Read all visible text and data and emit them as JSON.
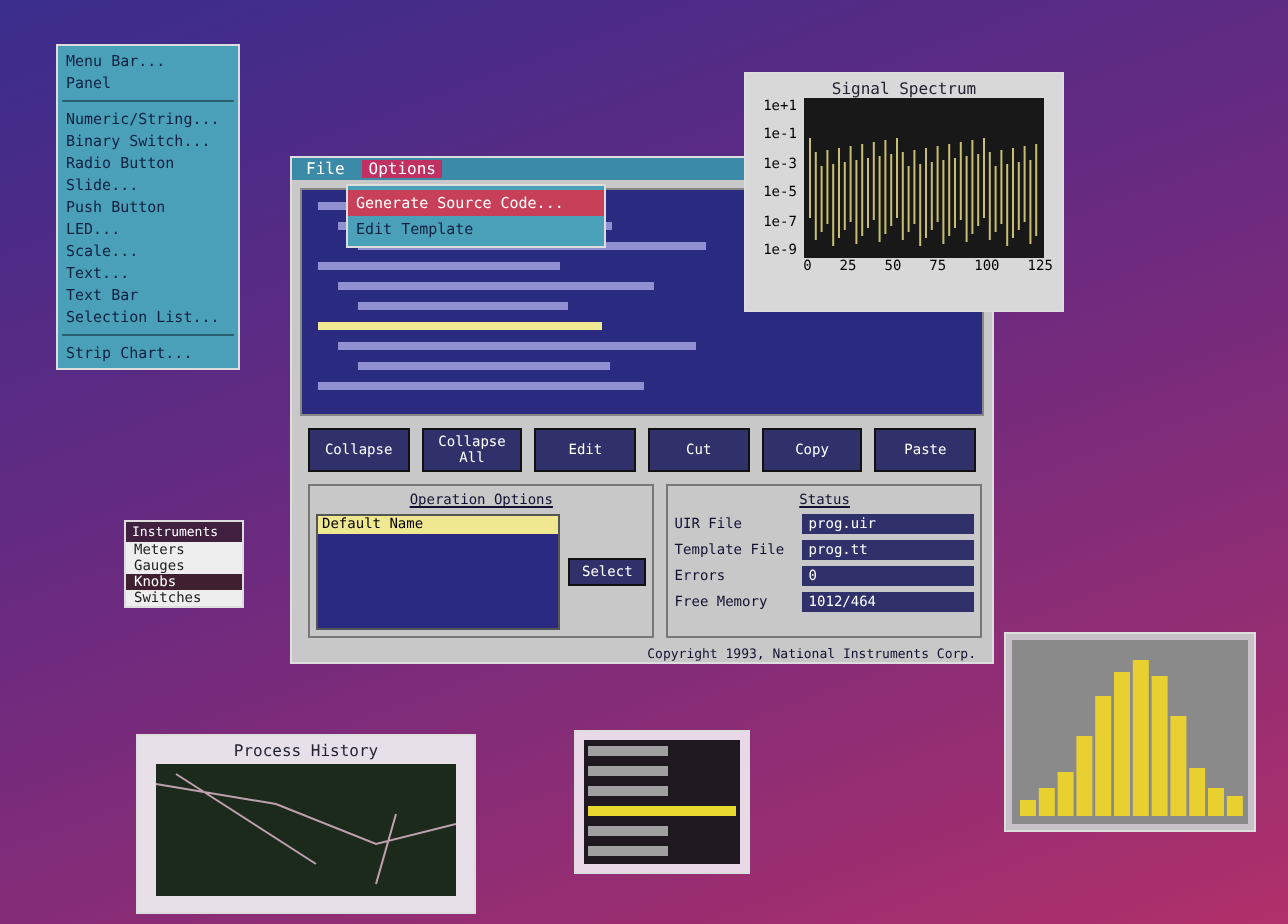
{
  "create_menu": {
    "items": [
      {
        "label": "Menu Bar...",
        "kind": "item",
        "selected": false
      },
      {
        "label": "Panel",
        "kind": "item",
        "selected": false
      },
      {
        "kind": "separator"
      },
      {
        "label": "Numeric/String...",
        "kind": "item",
        "selected": false
      },
      {
        "label": "Binary Switch...",
        "kind": "item",
        "selected": false
      },
      {
        "label": "Radio Button",
        "kind": "item",
        "selected": false
      },
      {
        "label": "Slide...",
        "kind": "item",
        "selected": false
      },
      {
        "label": "Push Button",
        "kind": "item",
        "selected": false
      },
      {
        "label": "LED...",
        "kind": "item",
        "selected": false
      },
      {
        "label": "Scale...",
        "kind": "item",
        "selected": false
      },
      {
        "label": "Text...",
        "kind": "item",
        "selected": false
      },
      {
        "label": "Text Bar",
        "kind": "item",
        "selected": false
      },
      {
        "label": "Selection List...",
        "kind": "item",
        "selected": false
      },
      {
        "kind": "separator"
      },
      {
        "label": "Strip Chart...",
        "kind": "item",
        "selected": false
      }
    ]
  },
  "editor": {
    "menu": [
      {
        "label": "File",
        "selected": false
      },
      {
        "label": "Options",
        "selected": true
      }
    ],
    "dropdown": [
      {
        "label": "Generate Source Code...",
        "selected": true
      },
      {
        "label": "Edit Template",
        "selected": false
      }
    ],
    "buttons": [
      "Collapse",
      "Collapse All",
      "Edit",
      "Cut",
      "Copy",
      "Paste"
    ],
    "options": {
      "title": "Operation Options",
      "select_button": "Select",
      "items": [
        {
          "label": "Default Name",
          "selected": true
        }
      ]
    },
    "status": {
      "title": "Status",
      "fields": [
        {
          "label": "UIR File",
          "value": "prog.uir"
        },
        {
          "label": "Template File",
          "value": "prog.tt"
        },
        {
          "label": "Errors",
          "value": "0"
        },
        {
          "label": "Free Memory",
          "value": "1012/464"
        }
      ]
    },
    "copyright": "Copyright 1993, National Instruments Corp."
  },
  "spectrum": {
    "title": "Signal Spectrum",
    "yticks": [
      "1e+1",
      "1e-1",
      "1e-3",
      "1e-5",
      "1e-7",
      "1e-9"
    ],
    "xticks": [
      "0",
      "25",
      "50",
      "75",
      "100",
      "125"
    ]
  },
  "instruments": {
    "title": "Instruments",
    "items": [
      {
        "label": "Meters",
        "selected": false
      },
      {
        "label": "Gauges",
        "selected": false
      },
      {
        "label": "Knobs",
        "selected": true
      },
      {
        "label": "Switches",
        "selected": false
      }
    ]
  },
  "history": {
    "title": "Process History"
  }
}
